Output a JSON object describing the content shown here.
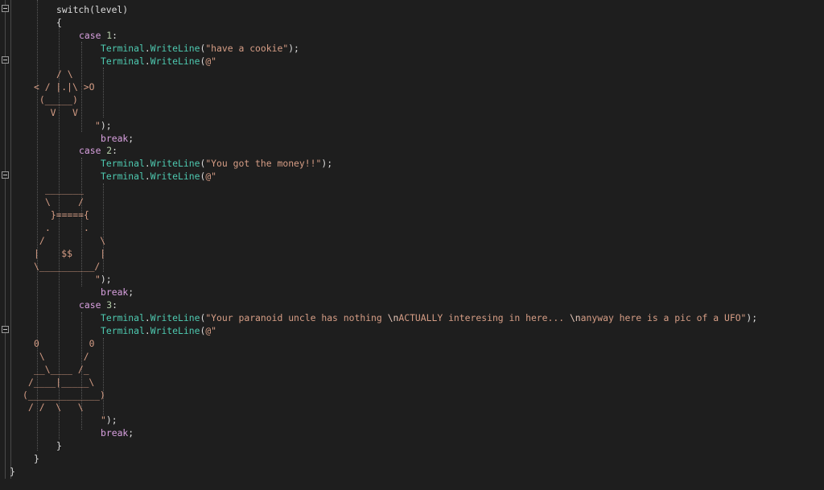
{
  "editor": {
    "language": "C#",
    "theme_colors": {
      "background": "#1e1e1e",
      "plain": "#dcdcdc",
      "keyword": "#d8a0df",
      "number": "#b5cea8",
      "string": "#d69d85",
      "escape": "#e8c9bb",
      "class": "#4ec9b0"
    },
    "fold_markers": [
      "collapse-icon",
      "collapse-icon",
      "collapse-icon",
      "collapse-icon"
    ],
    "lines": [
      {
        "indent": 70,
        "tokens": [
          {
            "t": "plain",
            "s": "switch(level)"
          }
        ]
      },
      {
        "indent": 70,
        "tokens": [
          {
            "t": "plain",
            "s": "{"
          }
        ]
      },
      {
        "indent": 98,
        "tokens": [
          {
            "t": "kw",
            "s": "case"
          },
          {
            "t": "plain",
            "s": " "
          },
          {
            "t": "num",
            "s": "1"
          },
          {
            "t": "plain",
            "s": ":"
          }
        ]
      },
      {
        "indent": 125,
        "tokens": [
          {
            "t": "cls",
            "s": "Terminal"
          },
          {
            "t": "plain",
            "s": "."
          },
          {
            "t": "cls",
            "s": "WriteLine"
          },
          {
            "t": "plain",
            "s": "("
          },
          {
            "t": "str",
            "s": "\"have a cookie\""
          },
          {
            "t": "plain",
            "s": ");"
          }
        ]
      },
      {
        "indent": 125,
        "tokens": [
          {
            "t": "cls",
            "s": "Terminal"
          },
          {
            "t": "plain",
            "s": "."
          },
          {
            "t": "cls",
            "s": "WriteLine"
          },
          {
            "t": "plain",
            "s": "("
          },
          {
            "t": "str",
            "s": "@\""
          }
        ]
      },
      {
        "indent": 70,
        "tokens": [
          {
            "t": "str",
            "s": "/ \\"
          }
        ]
      },
      {
        "indent": 42,
        "tokens": [
          {
            "t": "str",
            "s": "< / |.|\\ >O"
          }
        ]
      },
      {
        "indent": 42,
        "tokens": [
          {
            "t": "str",
            "s": " (_____)"
          }
        ]
      },
      {
        "indent": 42,
        "tokens": [
          {
            "t": "str",
            "s": "   V   V"
          }
        ]
      },
      {
        "indent": 118,
        "tokens": [
          {
            "t": "str",
            "s": "\""
          },
          {
            "t": "plain",
            "s": ");"
          }
        ]
      },
      {
        "indent": 125,
        "tokens": [
          {
            "t": "kw",
            "s": "break"
          },
          {
            "t": "plain",
            "s": ";"
          }
        ]
      },
      {
        "indent": 98,
        "tokens": [
          {
            "t": "kw",
            "s": "case"
          },
          {
            "t": "plain",
            "s": " "
          },
          {
            "t": "num",
            "s": "2"
          },
          {
            "t": "plain",
            "s": ":"
          }
        ]
      },
      {
        "indent": 125,
        "tokens": [
          {
            "t": "cls",
            "s": "Terminal"
          },
          {
            "t": "plain",
            "s": "."
          },
          {
            "t": "cls",
            "s": "WriteLine"
          },
          {
            "t": "plain",
            "s": "("
          },
          {
            "t": "str",
            "s": "\"You got the money!!\""
          },
          {
            "t": "plain",
            "s": ");"
          }
        ]
      },
      {
        "indent": 125,
        "tokens": [
          {
            "t": "cls",
            "s": "Terminal"
          },
          {
            "t": "plain",
            "s": "."
          },
          {
            "t": "cls",
            "s": "WriteLine"
          },
          {
            "t": "plain",
            "s": "("
          },
          {
            "t": "str",
            "s": "@\""
          }
        ]
      },
      {
        "indent": 56,
        "tokens": [
          {
            "t": "str",
            "s": "_______"
          }
        ]
      },
      {
        "indent": 56,
        "tokens": [
          {
            "t": "str",
            "s": "\\     /"
          }
        ]
      },
      {
        "indent": 56,
        "tokens": [
          {
            "t": "str",
            "s": " }====={"
          }
        ]
      },
      {
        "indent": 56,
        "tokens": [
          {
            "t": "str",
            "s": ".      ."
          }
        ]
      },
      {
        "indent": 42,
        "tokens": [
          {
            "t": "str",
            "s": " /          \\"
          }
        ]
      },
      {
        "indent": 42,
        "tokens": [
          {
            "t": "str",
            "s": "|    $$     |"
          }
        ]
      },
      {
        "indent": 42,
        "tokens": [
          {
            "t": "str",
            "s": "\\__________/"
          }
        ]
      },
      {
        "indent": 118,
        "tokens": [
          {
            "t": "str",
            "s": "\""
          },
          {
            "t": "plain",
            "s": ");"
          }
        ]
      },
      {
        "indent": 125,
        "tokens": [
          {
            "t": "kw",
            "s": "break"
          },
          {
            "t": "plain",
            "s": ";"
          }
        ]
      },
      {
        "indent": 98,
        "tokens": [
          {
            "t": "kw",
            "s": "case"
          },
          {
            "t": "plain",
            "s": " "
          },
          {
            "t": "num",
            "s": "3"
          },
          {
            "t": "plain",
            "s": ":"
          }
        ]
      },
      {
        "indent": 125,
        "tokens": [
          {
            "t": "cls",
            "s": "Terminal"
          },
          {
            "t": "plain",
            "s": "."
          },
          {
            "t": "cls",
            "s": "WriteLine"
          },
          {
            "t": "plain",
            "s": "("
          },
          {
            "t": "str",
            "s": "\"Your paranoid uncle has nothing "
          },
          {
            "t": "esc",
            "s": "\\n"
          },
          {
            "t": "str",
            "s": "ACTUALLY interesing in here... "
          },
          {
            "t": "esc",
            "s": "\\n"
          },
          {
            "t": "str",
            "s": "anyway here is a pic of a UFO\""
          },
          {
            "t": "plain",
            "s": ");"
          }
        ]
      },
      {
        "indent": 125,
        "tokens": [
          {
            "t": "cls",
            "s": "Terminal"
          },
          {
            "t": "plain",
            "s": "."
          },
          {
            "t": "cls",
            "s": "WriteLine"
          },
          {
            "t": "plain",
            "s": "("
          },
          {
            "t": "str",
            "s": "@\""
          }
        ]
      },
      {
        "indent": 42,
        "tokens": [
          {
            "t": "str",
            "s": "0         0"
          }
        ]
      },
      {
        "indent": 42,
        "tokens": [
          {
            "t": "str",
            "s": " \\       /"
          }
        ]
      },
      {
        "indent": 42,
        "tokens": [
          {
            "t": "str",
            "s": "__\\____ /_"
          }
        ]
      },
      {
        "indent": 35,
        "tokens": [
          {
            "t": "str",
            "s": "/____|_____\\"
          }
        ]
      },
      {
        "indent": 28,
        "tokens": [
          {
            "t": "str",
            "s": "(_____________)"
          }
        ]
      },
      {
        "indent": 35,
        "tokens": [
          {
            "t": "str",
            "s": "/ /  \\   \\"
          }
        ]
      },
      {
        "indent": 125,
        "tokens": [
          {
            "t": "str",
            "s": "\""
          },
          {
            "t": "plain",
            "s": ");"
          }
        ]
      },
      {
        "indent": 125,
        "tokens": [
          {
            "t": "kw",
            "s": "break"
          },
          {
            "t": "plain",
            "s": ";"
          }
        ]
      },
      {
        "indent": 70,
        "tokens": [
          {
            "t": "plain",
            "s": "}"
          }
        ]
      },
      {
        "indent": 42,
        "tokens": [
          {
            "t": "plain",
            "s": "}"
          }
        ]
      },
      {
        "indent": 12,
        "tokens": [
          {
            "t": "plain",
            "s": "}"
          }
        ]
      }
    ]
  }
}
